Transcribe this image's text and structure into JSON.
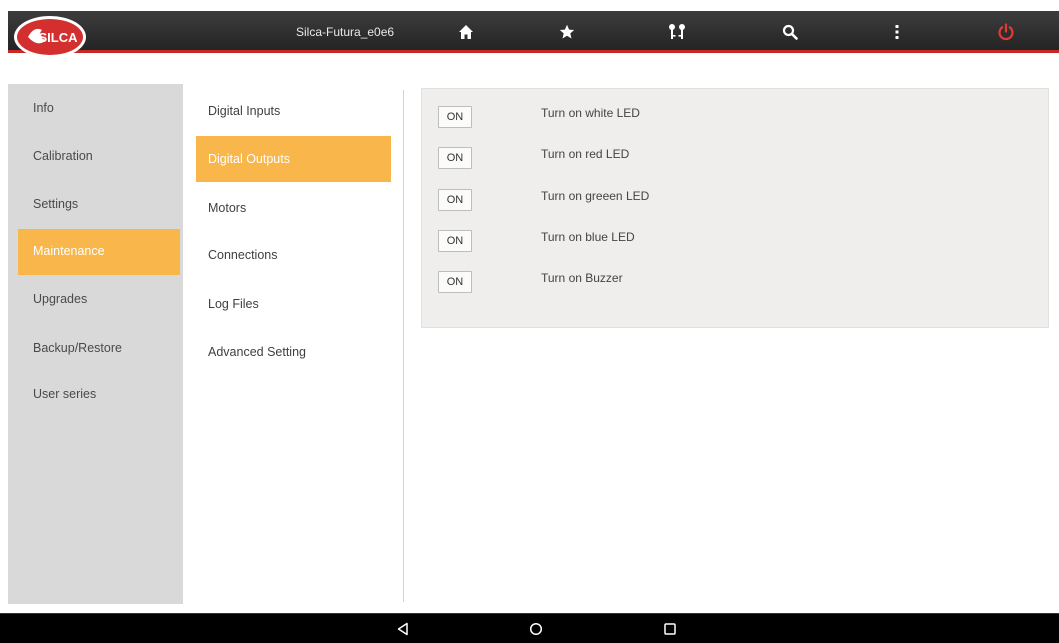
{
  "topbar": {
    "logo_text": "SILCA",
    "device_name": "Silca-Futura_e0e6",
    "icons": [
      "home-icon",
      "star-icon",
      "key-compare-icon",
      "search-icon",
      "more-vertical-icon",
      "power-icon"
    ],
    "accent": "#c62828",
    "power_color": "#e53935"
  },
  "sidebar": {
    "items": [
      {
        "label": "Info"
      },
      {
        "label": "Calibration"
      },
      {
        "label": "Settings"
      },
      {
        "label": "Maintenance",
        "active": true
      },
      {
        "label": "Upgrades"
      },
      {
        "label": "Backup/Restore"
      },
      {
        "label": "User series"
      }
    ]
  },
  "submenu": {
    "items": [
      {
        "label": "Digital Inputs"
      },
      {
        "label": "Digital Outputs",
        "active": true
      },
      {
        "label": "Motors"
      },
      {
        "label": "Connections"
      },
      {
        "label": "Log Files"
      },
      {
        "label": "Advanced Setting"
      }
    ]
  },
  "outputs": [
    {
      "button": "ON",
      "label": "Turn on white LED"
    },
    {
      "button": "ON",
      "label": "Turn on red LED"
    },
    {
      "button": "ON",
      "label": "Turn on greeen LED"
    },
    {
      "button": "ON",
      "label": "Turn on blue LED"
    },
    {
      "button": "ON",
      "label": "Turn on Buzzer"
    }
  ],
  "navbar": {
    "icons": [
      "back-icon",
      "home-circle-icon",
      "recents-icon"
    ]
  },
  "colors": {
    "active_item": "#f8b64b",
    "sidebar_bg": "#d9d9d9"
  }
}
